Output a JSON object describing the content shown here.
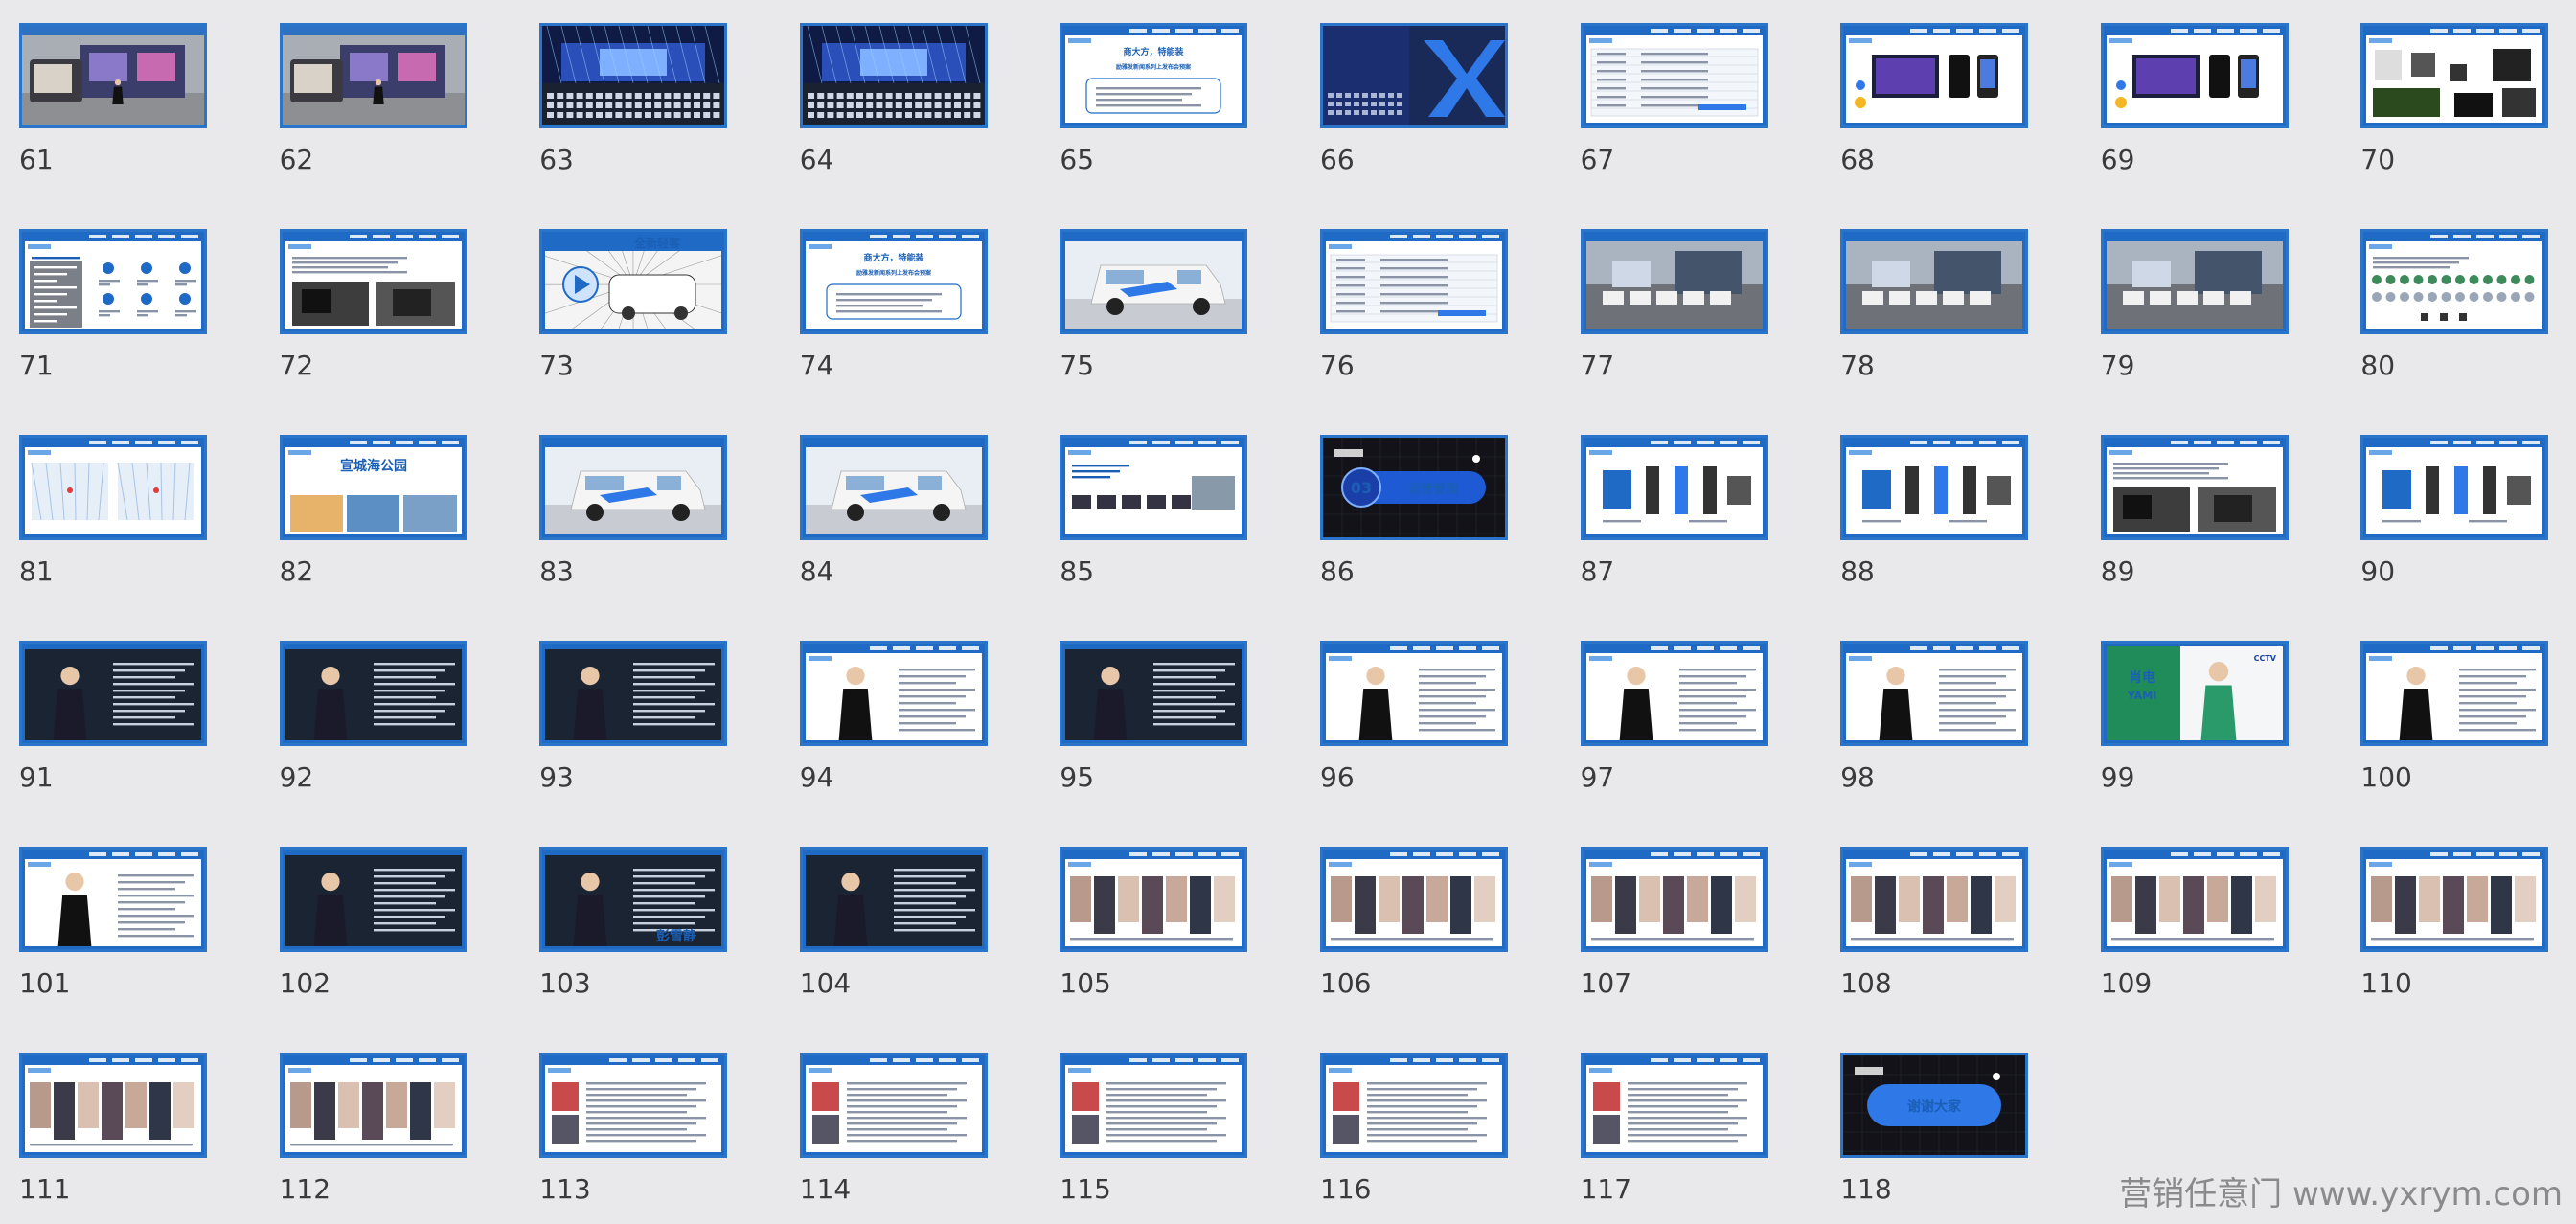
{
  "watermark": "营销任意门 www.yxrym.com",
  "slides": [
    {
      "n": "61",
      "t": "venue",
      "lines": []
    },
    {
      "n": "62",
      "t": "venue",
      "lines": []
    },
    {
      "n": "63",
      "t": "stage",
      "lines": []
    },
    {
      "n": "64",
      "t": "stage",
      "lines": []
    },
    {
      "n": "65",
      "t": "title",
      "lines": [
        "商大方，特能装",
        "励雅发新闻系列上发布会预案"
      ]
    },
    {
      "n": "66",
      "t": "x",
      "lines": []
    },
    {
      "n": "67",
      "t": "table",
      "lines": []
    },
    {
      "n": "68",
      "t": "screens",
      "lines": []
    },
    {
      "n": "69",
      "t": "screens",
      "lines": []
    },
    {
      "n": "70",
      "t": "equipment",
      "lines": []
    },
    {
      "n": "71",
      "t": "icons",
      "lines": []
    },
    {
      "n": "72",
      "t": "photos",
      "lines": []
    },
    {
      "n": "73",
      "t": "comic",
      "lines": [
        "全新轻客"
      ]
    },
    {
      "n": "74",
      "t": "title",
      "lines": [
        "商大方，特能装",
        "励雅发新闻系列上发布会预案"
      ]
    },
    {
      "n": "75",
      "t": "van",
      "lines": []
    },
    {
      "n": "76",
      "t": "table",
      "lines": []
    },
    {
      "n": "77",
      "t": "outdoor",
      "lines": []
    },
    {
      "n": "78",
      "t": "outdoor",
      "lines": []
    },
    {
      "n": "79",
      "t": "outdoor",
      "lines": []
    },
    {
      "n": "80",
      "t": "people-row",
      "lines": []
    },
    {
      "n": "81",
      "t": "maps",
      "lines": []
    },
    {
      "n": "82",
      "t": "landscape",
      "lines": [
        "宣城海公园"
      ]
    },
    {
      "n": "83",
      "t": "van",
      "lines": []
    },
    {
      "n": "84",
      "t": "van",
      "lines": []
    },
    {
      "n": "85",
      "t": "flow",
      "lines": []
    },
    {
      "n": "86",
      "t": "dark",
      "lines": [
        "03",
        "运营管理"
      ]
    },
    {
      "n": "87",
      "t": "products",
      "lines": []
    },
    {
      "n": "88",
      "t": "products",
      "lines": []
    },
    {
      "n": "89",
      "t": "photos",
      "lines": []
    },
    {
      "n": "90",
      "t": "products",
      "lines": []
    },
    {
      "n": "91",
      "t": "person-dark",
      "lines": []
    },
    {
      "n": "92",
      "t": "person-dark",
      "lines": []
    },
    {
      "n": "93",
      "t": "person-dark",
      "lines": []
    },
    {
      "n": "94",
      "t": "person-light",
      "lines": []
    },
    {
      "n": "95",
      "t": "person-dark",
      "lines": []
    },
    {
      "n": "96",
      "t": "person-light",
      "lines": []
    },
    {
      "n": "97",
      "t": "person-light",
      "lines": []
    },
    {
      "n": "98",
      "t": "person-light",
      "lines": []
    },
    {
      "n": "99",
      "t": "cctv",
      "lines": [
        "肖电",
        "YAMI"
      ]
    },
    {
      "n": "100",
      "t": "person-light",
      "lines": []
    },
    {
      "n": "101",
      "t": "person-light",
      "lines": []
    },
    {
      "n": "102",
      "t": "person-dark",
      "lines": []
    },
    {
      "n": "103",
      "t": "person-dark",
      "lines": [
        "彭雪静"
      ]
    },
    {
      "n": "104",
      "t": "person-dark",
      "lines": []
    },
    {
      "n": "105",
      "t": "gallery",
      "lines": []
    },
    {
      "n": "106",
      "t": "gallery",
      "lines": []
    },
    {
      "n": "107",
      "t": "gallery",
      "lines": []
    },
    {
      "n": "108",
      "t": "gallery",
      "lines": []
    },
    {
      "n": "109",
      "t": "gallery",
      "lines": []
    },
    {
      "n": "110",
      "t": "gallery",
      "lines": []
    },
    {
      "n": "111",
      "t": "gallery",
      "lines": []
    },
    {
      "n": "112",
      "t": "gallery",
      "lines": []
    },
    {
      "n": "113",
      "t": "doc",
      "lines": []
    },
    {
      "n": "114",
      "t": "doc",
      "lines": []
    },
    {
      "n": "115",
      "t": "doc",
      "lines": []
    },
    {
      "n": "116",
      "t": "doc",
      "lines": []
    },
    {
      "n": "117",
      "t": "doc",
      "lines": []
    },
    {
      "n": "118",
      "t": "dark",
      "lines": [
        "谢谢大家"
      ]
    }
  ]
}
